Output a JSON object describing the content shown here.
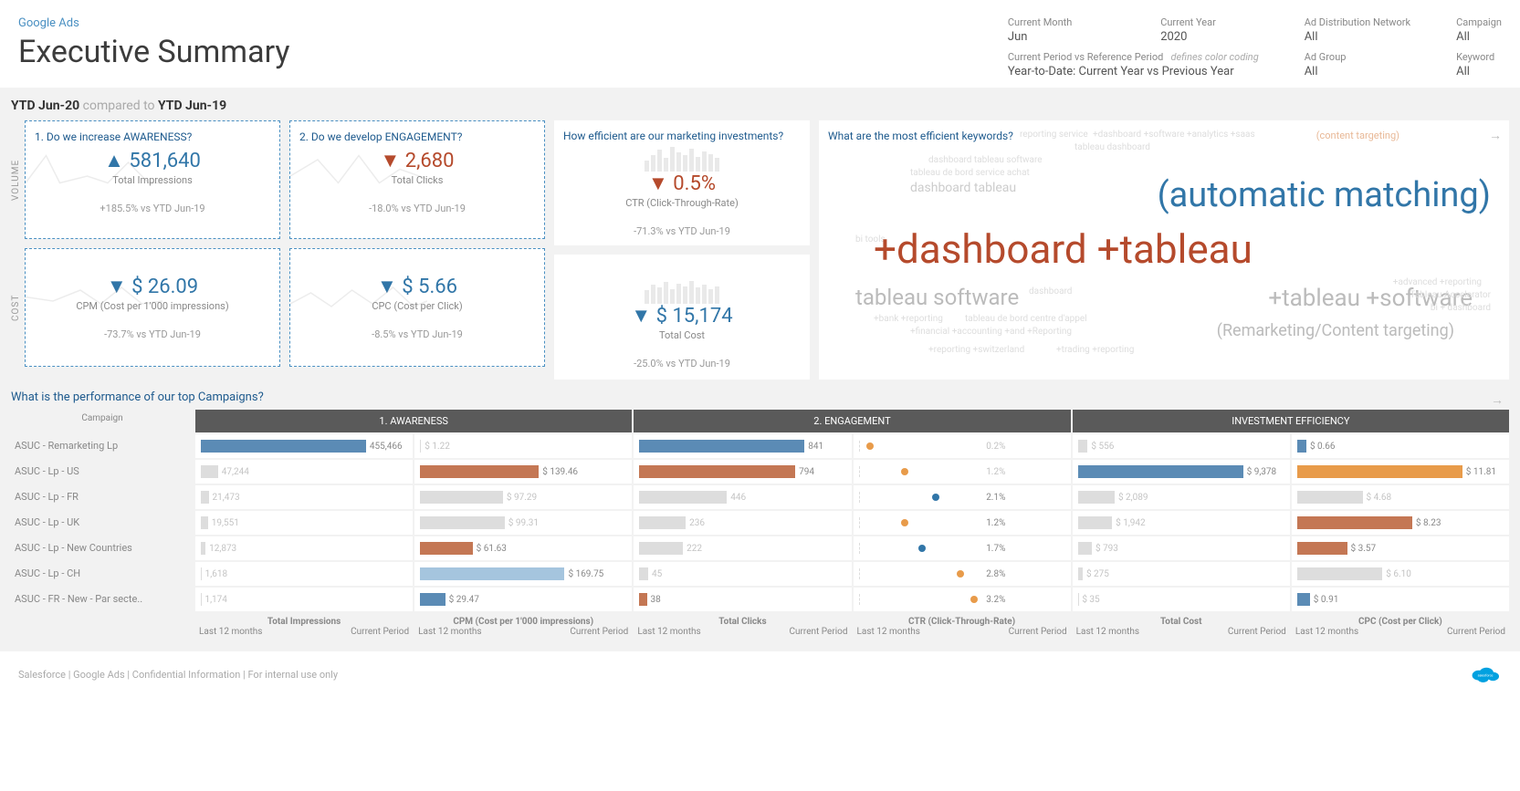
{
  "header": {
    "subtitle": "Google Ads",
    "title": "Executive Summary"
  },
  "filters": {
    "month_label": "Current Month",
    "month": "Jun",
    "year_label": "Current Year",
    "year": "2020",
    "network_label": "Ad Distribution Network",
    "network": "All",
    "campaign_label": "Campaign",
    "campaign": "All",
    "period_label": "Current Period vs Reference Period",
    "period_hint": "defines color coding",
    "period": "Year-to-Date: Current Year vs Previous Year",
    "adgroup_label": "Ad Group",
    "adgroup": "All",
    "keyword_label": "Keyword",
    "keyword": "All"
  },
  "ytd": {
    "current": "YTD Jun-20",
    "compared": "compared to",
    "prev": "YTD Jun-19"
  },
  "side": {
    "volume": "VOLUME",
    "cost": "COST"
  },
  "q": {
    "awareness": "1. Do we increase AWARENESS?",
    "engagement": "2. Do we develop ENGAGEMENT?",
    "efficiency": "How efficient are our marketing investments?",
    "keywords": "What are the most efficient keywords?",
    "campaigns": "What is the performance of our top Campaigns?"
  },
  "kpi": {
    "impressions": {
      "arrow": "▲",
      "val": "581,640",
      "label": "Total Impressions",
      "delta": "+185.5% vs YTD Jun-19"
    },
    "clicks": {
      "arrow": "▼",
      "val": "2,680",
      "label": "Total Clicks",
      "delta": "-18.0% vs YTD Jun-19"
    },
    "ctr": {
      "arrow": "▼",
      "val": "0.5%",
      "label": "CTR (Click-Through-Rate)",
      "delta": "-71.3% vs YTD Jun-19"
    },
    "cpm": {
      "arrow": "▼",
      "val": "$ 26.09",
      "label": "CPM (Cost per 1'000 impressions)",
      "delta": "-73.7% vs YTD Jun-19"
    },
    "cpc": {
      "arrow": "▼",
      "val": "$ 5.66",
      "label": "CPC (Cost per Click)",
      "delta": "-8.5% vs YTD Jun-19"
    },
    "cost": {
      "arrow": "▼",
      "val": "$ 15,174",
      "label": "Total Cost",
      "delta": "-25.0% vs YTD Jun-19"
    }
  },
  "wordcloud": {
    "ct": "(content targeting)",
    "big1": "(automatic matching)",
    "big2": "+dashboard +tableau",
    "med1": "tableau software",
    "med2": "+tableau +software",
    "med3": "(Remarketing/Content targeting)",
    "dt": "dashboard tableau",
    "small": [
      "reporting service",
      "+dashboard +software +analytics +saas",
      "tableau dashboard",
      "dashboard tableau software",
      "tableau de bord service achat",
      "bi tools",
      "dashboard",
      "+bank +reporting",
      "tableau de bord centre d'appel",
      "+financial +accounting +and +Reporting",
      "+reporting +switzerland",
      "+trading +reporting",
      "Tableau Accelerator",
      "bi + dashboard",
      "+advanced +reporting"
    ]
  },
  "sections": {
    "h1": "1. AWARENESS",
    "h2": "2. ENGAGEMENT",
    "h3": "INVESTMENT EFFICIENCY"
  },
  "cols": {
    "campaign": "Campaign",
    "impressions": "Total Impressions",
    "cpm": "CPM (Cost per 1'000 impressions)",
    "clicks": "Total Clicks",
    "ctr": "CTR (Click-Through-Rate)",
    "cost": "Total Cost",
    "cpc": "CPC (Cost per Click)",
    "last12": "Last 12 months",
    "current": "Current Period"
  },
  "campaigns": [
    {
      "name": "ASUC - Remarketing Lp",
      "imp": 455466,
      "imp_txt": "455,466",
      "cpm": 1.22,
      "cpm_txt": "$ 1.22",
      "clicks": 841,
      "ctr": 0.2,
      "ctr_txt": "0.2%",
      "cost": 556,
      "cost_txt": "$ 556",
      "cpc": 0.66,
      "cpc_txt": "$ 0.66",
      "c_imp": "blue",
      "c_cpm": "grey",
      "c_clk": "blue",
      "c_ctr": "grey",
      "c_cost": "grey",
      "c_cpc": "blue"
    },
    {
      "name": "ASUC - Lp - US",
      "imp": 47244,
      "imp_txt": "47,244",
      "cpm": 139.46,
      "cpm_txt": "$ 139.46",
      "clicks": 794,
      "ctr": 1.2,
      "ctr_txt": "1.2%",
      "cost": 9378,
      "cost_txt": "$ 9,378",
      "cpc": 11.81,
      "cpc_txt": "$ 11.81",
      "c_imp": "grey",
      "c_cpm": "red",
      "c_clk": "red",
      "c_ctr": "grey",
      "c_cost": "blue",
      "c_cpc": "orange"
    },
    {
      "name": "ASUC - Lp - FR",
      "imp": 21473,
      "imp_txt": "21,473",
      "cpm": 97.29,
      "cpm_txt": "$ 97.29",
      "clicks": 446,
      "ctr": 2.1,
      "ctr_txt": "2.1%",
      "cost": 2089,
      "cost_txt": "$ 2,089",
      "cpc": 4.68,
      "cpc_txt": "$ 4.68",
      "c_imp": "grey",
      "c_cpm": "grey",
      "c_clk": "grey",
      "c_ctr": "blue",
      "c_cost": "grey",
      "c_cpc": "grey"
    },
    {
      "name": "ASUC - Lp - UK",
      "imp": 19551,
      "imp_txt": "19,551",
      "cpm": 99.31,
      "cpm_txt": "$ 99.31",
      "clicks": 236,
      "ctr": 1.2,
      "ctr_txt": "1.2%",
      "cost": 1942,
      "cost_txt": "$ 1,942",
      "cpc": 8.23,
      "cpc_txt": "$ 8.23",
      "c_imp": "grey",
      "c_cpm": "grey",
      "c_clk": "grey",
      "c_ctr": "orange",
      "c_cost": "grey",
      "c_cpc": "red"
    },
    {
      "name": "ASUC - Lp - New Countries",
      "imp": 12873,
      "imp_txt": "12,873",
      "cpm": 61.63,
      "cpm_txt": "$ 61.63",
      "clicks": 222,
      "ctr": 1.7,
      "ctr_txt": "1.7%",
      "cost": 793,
      "cost_txt": "$ 793",
      "cpc": 3.57,
      "cpc_txt": "$ 3.57",
      "c_imp": "grey",
      "c_cpm": "red",
      "c_clk": "grey",
      "c_ctr": "blue",
      "c_cost": "grey",
      "c_cpc": "red"
    },
    {
      "name": "ASUC - Lp - CH",
      "imp": 1618,
      "imp_txt": "1,618",
      "cpm": 169.75,
      "cpm_txt": "$ 169.75",
      "clicks": 45,
      "ctr": 2.8,
      "ctr_txt": "2.8%",
      "cost": 275,
      "cost_txt": "$ 275",
      "cpc": 6.1,
      "cpc_txt": "$ 6.10",
      "c_imp": "grey",
      "c_cpm": "lblue",
      "c_clk": "grey",
      "c_ctr": "orange",
      "c_cost": "grey",
      "c_cpc": "grey"
    },
    {
      "name": "ASUC - FR - New - Par secte..",
      "imp": 1174,
      "imp_txt": "1,174",
      "cpm": 29.47,
      "cpm_txt": "$ 29.47",
      "clicks": 38,
      "ctr": 3.2,
      "ctr_txt": "3.2%",
      "cost": 35,
      "cost_txt": "$ 35",
      "cpc": 0.91,
      "cpc_txt": "$ 0.91",
      "c_imp": "grey",
      "c_cpm": "blue",
      "c_clk": "red",
      "c_ctr": "orange",
      "c_cost": "grey",
      "c_cpc": "blue"
    }
  ],
  "chart_data": {
    "type": "bar",
    "note": "Dashboard with 6 KPI summary tiles, a keyword word-cloud, and a 7-row campaign table with 6 metric columns (Impressions, CPM, Clicks, CTR, Cost, CPC).",
    "kpis": [
      {
        "metric": "Total Impressions",
        "value": 581640,
        "delta_pct": 185.5,
        "direction": "up"
      },
      {
        "metric": "Total Clicks",
        "value": 2680,
        "delta_pct": -18.0,
        "direction": "down"
      },
      {
        "metric": "CTR",
        "value": 0.005,
        "delta_pct": -71.3,
        "direction": "down"
      },
      {
        "metric": "CPM",
        "value": 26.09,
        "delta_pct": -73.7,
        "direction": "down"
      },
      {
        "metric": "CPC",
        "value": 5.66,
        "delta_pct": -8.5,
        "direction": "down"
      },
      {
        "metric": "Total Cost",
        "value": 15174,
        "delta_pct": -25.0,
        "direction": "down"
      }
    ],
    "campaign_table": {
      "categories": [
        "ASUC - Remarketing Lp",
        "ASUC - Lp - US",
        "ASUC - Lp - FR",
        "ASUC - Lp - UK",
        "ASUC - Lp - New Countries",
        "ASUC - Lp - CH",
        "ASUC - FR - New - Par secte.."
      ],
      "series": [
        {
          "name": "Total Impressions",
          "values": [
            455466,
            47244,
            21473,
            19551,
            12873,
            1618,
            1174
          ]
        },
        {
          "name": "CPM",
          "values": [
            1.22,
            139.46,
            97.29,
            99.31,
            61.63,
            169.75,
            29.47
          ]
        },
        {
          "name": "Total Clicks",
          "values": [
            841,
            794,
            446,
            236,
            222,
            45,
            38
          ]
        },
        {
          "name": "CTR %",
          "values": [
            0.2,
            1.2,
            2.1,
            1.2,
            1.7,
            2.8,
            3.2
          ]
        },
        {
          "name": "Total Cost",
          "values": [
            556,
            9378,
            2089,
            1942,
            793,
            275,
            35
          ]
        },
        {
          "name": "CPC",
          "values": [
            0.66,
            11.81,
            4.68,
            8.23,
            3.57,
            6.1,
            0.91
          ]
        }
      ]
    }
  },
  "footer": "Salesforce | Google Ads | Confidential Information | For internal use only"
}
